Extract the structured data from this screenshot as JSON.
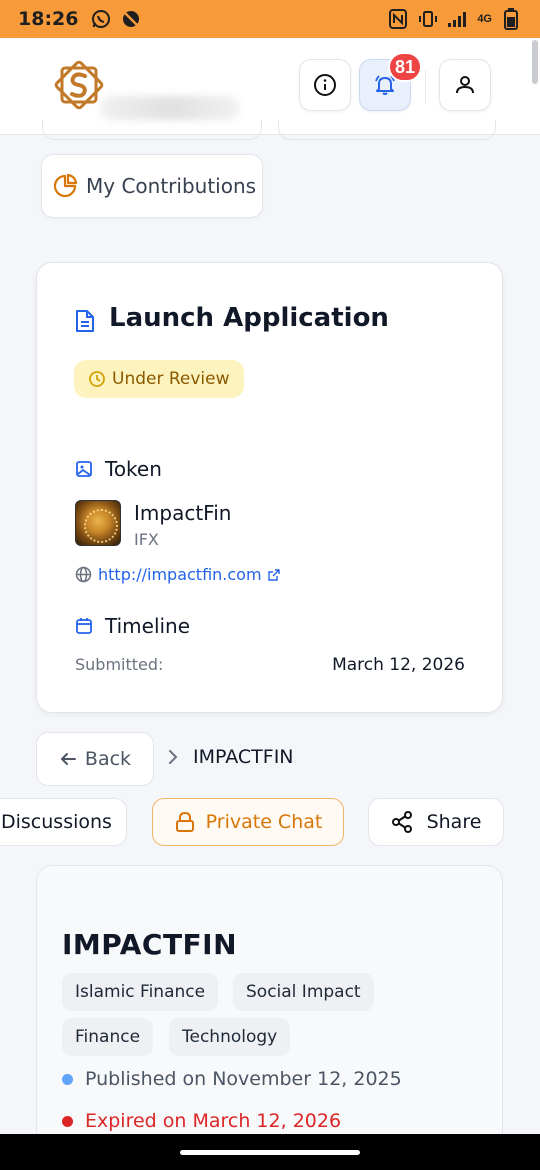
{
  "status_bar": {
    "time": "18:26",
    "network": "4G"
  },
  "header": {
    "notification_count": "81"
  },
  "contributions": {
    "label": "My Contributions"
  },
  "application": {
    "title": "Launch Application",
    "status": "Under Review",
    "token_heading": "Token",
    "token_name": "ImpactFin",
    "token_symbol": "IFX",
    "token_url": "http://impactfin.com",
    "timeline_heading": "Timeline",
    "submitted_label": "Submitted:",
    "submitted_value": "March 12, 2026"
  },
  "nav": {
    "back_label": "Back",
    "crumb": "IMPACTFIN"
  },
  "actions": {
    "discussions": "Discussions",
    "private_chat": "Private Chat",
    "share": "Share"
  },
  "project": {
    "name": "IMPACTFIN",
    "tags": [
      "Islamic Finance",
      "Social Impact",
      "Finance",
      "Technology"
    ],
    "published": "Published on November 12, 2025",
    "expired": "Expired on March 12, 2026"
  },
  "colors": {
    "accent": "#f79a3a",
    "link": "#2563eb",
    "danger": "#dc2626",
    "info_dot": "#60a5fa",
    "chat": "#d97706"
  }
}
